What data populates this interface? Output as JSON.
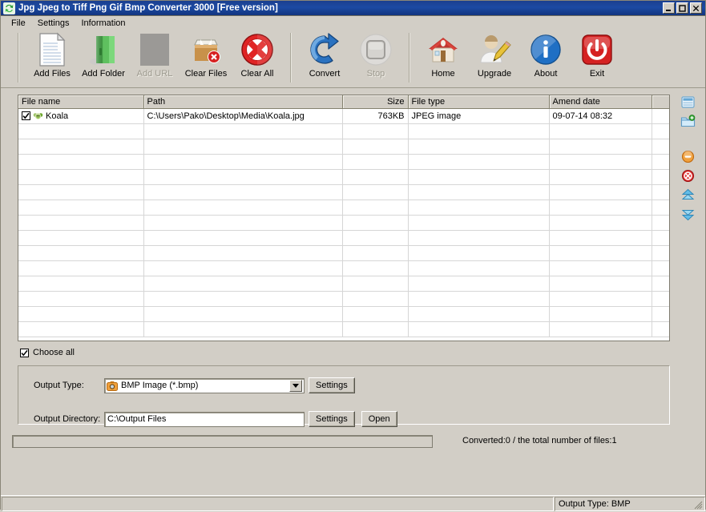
{
  "window": {
    "title": "Jpg Jpeg to Tiff Png Gif Bmp Converter 3000 [Free version]",
    "app_icon": "convert-recycle-icon",
    "controls": {
      "minimize": "minimize-icon",
      "maximize": "maximize-icon",
      "close": "close-icon"
    },
    "accent_titlebar": "#1c4aa3",
    "background": "#d2cec6"
  },
  "menu": {
    "items": [
      {
        "label": "File"
      },
      {
        "label": "Settings"
      },
      {
        "label": "Information"
      }
    ]
  },
  "toolbar": {
    "groups": [
      {
        "buttons": [
          {
            "label": "Add Files",
            "icon": "document-page-icon",
            "enabled": true
          },
          {
            "label": "Add Folder",
            "icon": "green-folder-icon",
            "enabled": true
          },
          {
            "label": "Add URL",
            "icon": "url-globe-icon",
            "enabled": false
          },
          {
            "label": "Clear Files",
            "icon": "box-remove-icon",
            "enabled": true
          },
          {
            "label": "Clear All",
            "icon": "red-cross-circle-icon",
            "enabled": true
          }
        ]
      },
      {
        "buttons": [
          {
            "label": "Convert",
            "icon": "convert-arrow-icon",
            "enabled": true
          },
          {
            "label": "Stop",
            "icon": "stop-square-icon",
            "enabled": false
          }
        ]
      },
      {
        "buttons": [
          {
            "label": "Home",
            "icon": "house-icon",
            "enabled": true
          },
          {
            "label": "Upgrade",
            "icon": "user-pencil-icon",
            "enabled": true
          },
          {
            "label": "About",
            "icon": "info-circle-icon",
            "enabled": true
          },
          {
            "label": "Exit",
            "icon": "power-icon",
            "enabled": true
          }
        ]
      }
    ]
  },
  "file_list": {
    "columns": [
      {
        "label": "File name",
        "align": "left"
      },
      {
        "label": "Path",
        "align": "left"
      },
      {
        "label": "Size",
        "align": "right"
      },
      {
        "label": "File type",
        "align": "left"
      },
      {
        "label": "Amend date",
        "align": "left"
      },
      {
        "label": "",
        "align": "left"
      }
    ],
    "rows": [
      {
        "checked": true,
        "thumbnail": "koala-thumbnail-icon",
        "name": "Koala",
        "path": "C:\\Users\\Pako\\Desktop\\Media\\Koala.jpg",
        "size": "763KB",
        "type": "JPEG image",
        "date": "09-07-14 08:32"
      }
    ],
    "empty_row_count": 13
  },
  "side_rail": {
    "icons": [
      {
        "name": "window-list-icon"
      },
      {
        "name": "folder-add-icon"
      },
      {
        "name": "orange-minus-icon"
      },
      {
        "name": "red-delete-icon"
      },
      {
        "name": "move-up-icon"
      },
      {
        "name": "move-down-icon"
      }
    ]
  },
  "choose_all": {
    "label": "Choose all",
    "checked": true
  },
  "output": {
    "type_label": "Output Type:",
    "type_value": "BMP Image (*.bmp)",
    "type_icon": "camera-icon",
    "type_settings_label": "Settings",
    "dir_label": "Output Directory:",
    "dir_value": "C:\\Output Files",
    "dir_placeholder": "C:\\Output Files",
    "dir_settings_label": "Settings",
    "dir_open_label": "Open"
  },
  "progress": {
    "percent": 0,
    "status_text": "Converted:0  /  the total number of files:1"
  },
  "statusbar": {
    "left_text": "",
    "right_text": "Output Type: BMP"
  }
}
